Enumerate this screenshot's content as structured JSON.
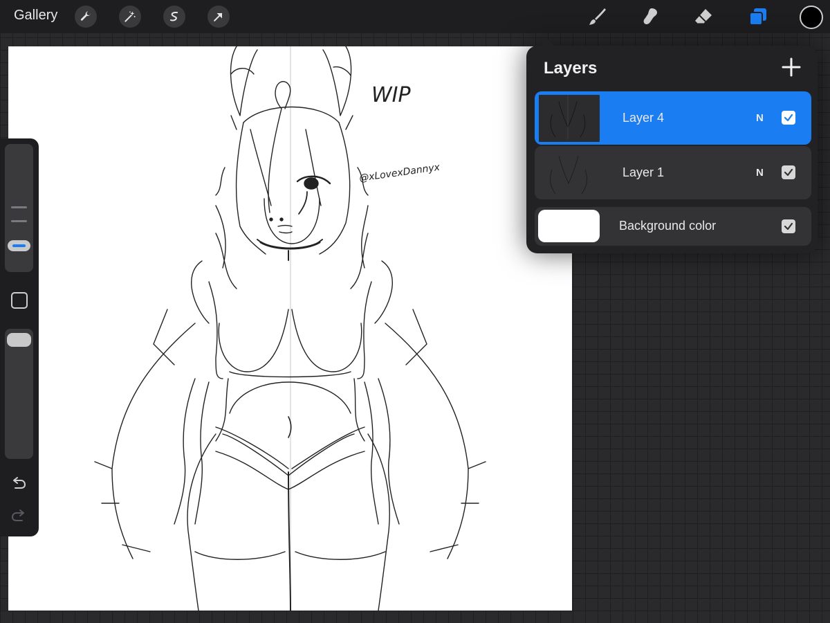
{
  "topbar": {
    "gallery_label": "Gallery",
    "actions": [
      "wrench-icon",
      "magic-wand-icon",
      "selection-icon",
      "transform-arrow-icon"
    ],
    "tools": [
      "brush-icon",
      "smudge-icon",
      "eraser-icon",
      "layers-icon"
    ],
    "active_tool": "layers-icon",
    "current_color": "#000000",
    "accent_color": "#1a7df2"
  },
  "canvas": {
    "annotation_wip": "WIP",
    "annotation_handle": "@xLovexDannyx"
  },
  "layers": {
    "title": "Layers",
    "items": [
      {
        "name": "Layer 4",
        "blend": "N",
        "visible": true,
        "selected": true
      },
      {
        "name": "Layer 1",
        "blend": "N",
        "visible": true,
        "selected": false
      }
    ],
    "background": {
      "name": "Background color",
      "visible": true,
      "color": "#ffffff"
    }
  }
}
